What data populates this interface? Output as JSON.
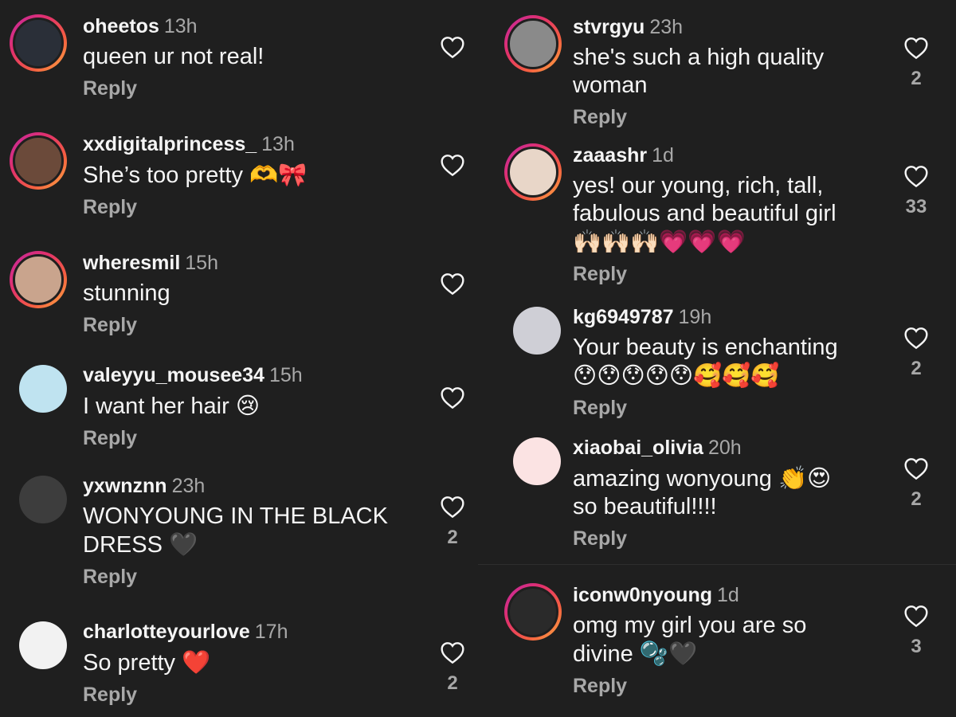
{
  "left": [
    {
      "username": "oheetos",
      "time": "13h",
      "text": "queen ur not real!",
      "emoji": "",
      "reply": "Reply",
      "likes": "",
      "avatar_color": "#2a2f38",
      "story": true
    },
    {
      "username": "xxdigitalprincess_",
      "time": "13h",
      "text": "She’s too pretty",
      "emoji": "🫶🎀",
      "reply": "Reply",
      "likes": "",
      "avatar_color": "#6b4a3a",
      "story": true
    },
    {
      "username": "wheresmil",
      "time": "15h",
      "text": "stunning",
      "emoji": "",
      "reply": "Reply",
      "likes": "",
      "avatar_color": "#c9a48d",
      "story": true
    },
    {
      "username": "valeyyu_mousee34",
      "time": "15h",
      "text": "I want her hair",
      "emoji": "😢",
      "reply": "Reply",
      "likes": "",
      "avatar_color": "#bfe3f0",
      "story": false
    },
    {
      "username": "yxwnznn",
      "time": "23h",
      "text": "WONYOUNG IN THE BLACK DRESS",
      "emoji": "🖤",
      "reply": "Reply",
      "likes": "2",
      "avatar_color": "#3d3d3d",
      "story": false
    },
    {
      "username": "charlotteyourlove",
      "time": "17h",
      "text": "So pretty",
      "emoji": "❤️",
      "reply": "Reply",
      "likes": "2",
      "avatar_color": "#f2f2f2",
      "story": false
    }
  ],
  "right": [
    {
      "username": "stvrgyu",
      "time": "23h",
      "text": "she's such a high quality woman",
      "emoji": "",
      "reply": "Reply",
      "likes": "2",
      "avatar_color": "#8a8a8a",
      "story": true
    },
    {
      "username": "zaaashr",
      "time": "1d",
      "text": "yes! our young, rich, tall, fabulous and beautiful girl",
      "emoji": "🙌🏻🙌🏻🙌🏻💗💗💗",
      "reply": "Reply",
      "likes": "33",
      "avatar_color": "#e8d6c8",
      "story": true
    },
    {
      "username": "kg6949787",
      "time": "19h",
      "text": "Your beauty is enchanting",
      "emoji": "😯😯😯😯😯🥰🥰🥰",
      "reply": "Reply",
      "likes": "2",
      "avatar_color": "#cfcfd6",
      "story": false
    },
    {
      "username": "xiaobai_olivia",
      "time": "20h",
      "text": "amazing wonyoung",
      "emoji": "👏😍",
      "text2": "so beautiful!!!!",
      "reply": "Reply",
      "likes": "2",
      "avatar_color": "#fbe3e3",
      "story": false
    },
    {
      "username": "iconw0nyoung",
      "time": "1d",
      "text": "omg my girl you are so divine",
      "emoji": "🫧🖤",
      "reply": "Reply",
      "likes": "3",
      "avatar_color": "#2a2a2a",
      "story": true
    }
  ],
  "colors": {
    "background": "#1f1f1f",
    "text": "#f5f5f5",
    "muted": "#a8a8a8"
  },
  "icons": {
    "like": "heart-outline-icon"
  }
}
